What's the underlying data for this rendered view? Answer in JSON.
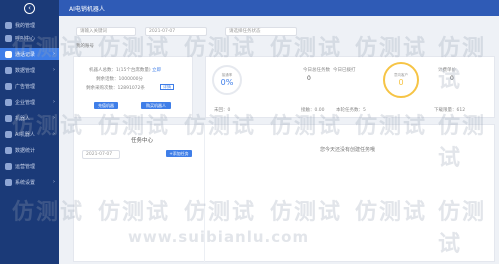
{
  "header": {
    "title": "AI电销机器人",
    "back_icon": "‹"
  },
  "sidebar": {
    "items": [
      {
        "label": "我的管理",
        "active": false,
        "caret": ""
      },
      {
        "label": "呼叫中心",
        "active": false,
        "caret": ""
      },
      {
        "label": "通话记录",
        "active": true,
        "caret": "›"
      },
      {
        "label": "数据管理",
        "active": false,
        "caret": "›"
      },
      {
        "label": "广告管理",
        "active": false,
        "caret": ""
      },
      {
        "label": "企业管理",
        "active": false,
        "caret": "›"
      },
      {
        "label": "机器人",
        "active": false,
        "caret": "›"
      },
      {
        "label": "AI机器人",
        "active": false,
        "caret": "›"
      },
      {
        "label": "数据统计",
        "active": false,
        "caret": ""
      },
      {
        "label": "运营管理",
        "active": false,
        "caret": ""
      },
      {
        "label": "系统设置",
        "active": false,
        "caret": "›"
      }
    ]
  },
  "filters": {
    "keyword_placeholder": "请输入关键词",
    "date_value": "2021-07-07",
    "status_placeholder": "请选择任务状态",
    "row_label": "我的账号"
  },
  "account": {
    "line1_label": "机器人总数：",
    "line1_value": "1(15个台席数量)",
    "line1_link": "立即",
    "line2_label": "剩余话数：",
    "line2_value": "1000000分",
    "line3_label": "剩余采购次数：",
    "line3_value": "12891072条",
    "line3_btn": "详情",
    "btn_create": "充值机器",
    "btn_buy": "购买机器人"
  },
  "stats": {
    "ring1_pct": "0%",
    "ring1_cap": "接通率",
    "ring1_foot": "未回：0",
    "mid_top": "今日总任务数",
    "mid_top_val": "0",
    "mid_foot": "接触：0.00",
    "mid2_top": "今日已拨打",
    "mid2_foot": "本轮任务数：5",
    "ring2_pct": "0",
    "ring2_cap": "意向客户",
    "right_top": "计费单价",
    "right_val": "0",
    "right_foot": "下载限量：612"
  },
  "tasks": {
    "title": "任务中心",
    "date": "2021-07-07",
    "add_btn": "+添加任务",
    "empty": "您今天还没有创建任务哦"
  },
  "watermark": {
    "text": "仿测试",
    "url": "www.suibianlu.com"
  }
}
